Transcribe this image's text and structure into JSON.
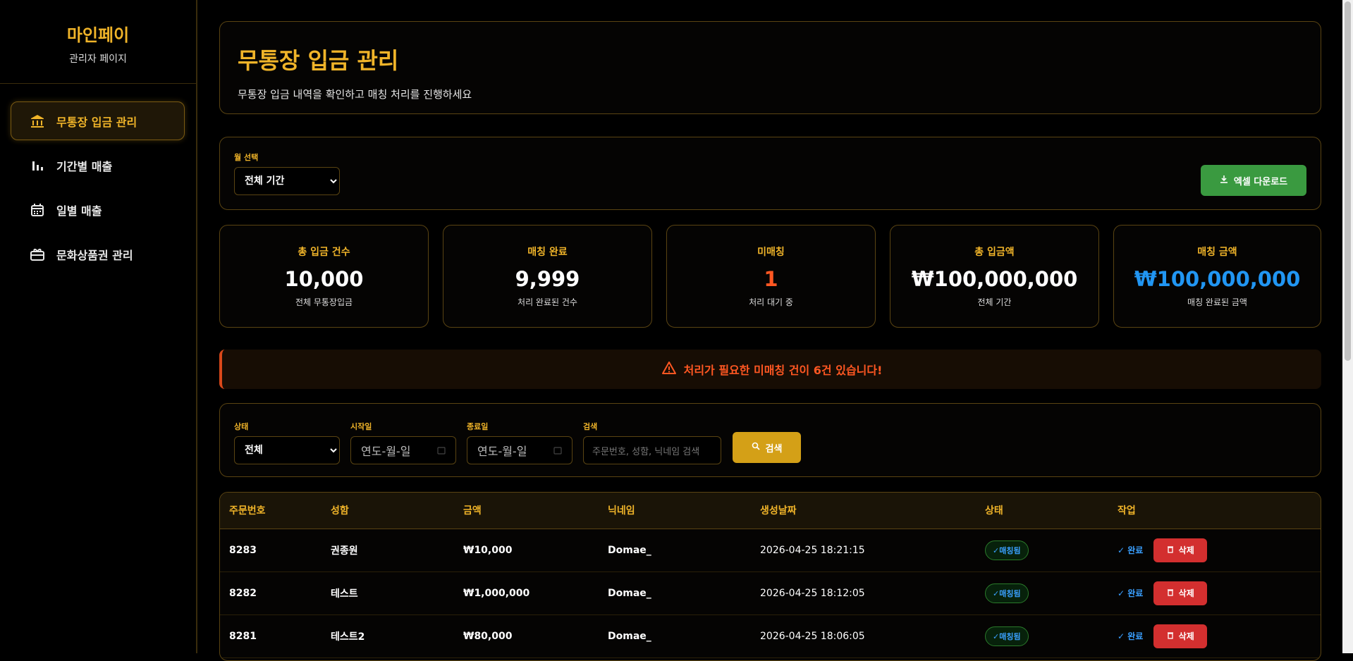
{
  "brand": {
    "title": "마인페이",
    "subtitle": "관리자 페이지"
  },
  "sidebar": {
    "items": [
      {
        "label": "무통장 입금 관리",
        "icon": "bank-icon",
        "active": true
      },
      {
        "label": "기간별 매출",
        "icon": "bar-chart-icon"
      },
      {
        "label": "일별 매출",
        "icon": "calendar-icon"
      },
      {
        "label": "문화상품권 관리",
        "icon": "gift-card-icon"
      }
    ]
  },
  "header": {
    "title": "무통장 입금 관리",
    "subtitle": "무통장 입금 내역을 확인하고 매칭 처리를 진행하세요"
  },
  "month": {
    "label": "월 선택",
    "selected": "전체 기간",
    "excel_button": "엑셀 다운로드"
  },
  "stats": [
    {
      "title": "총 입금 건수",
      "value": "10,000",
      "sub": "전체 무통장입금",
      "color": "#ffffff"
    },
    {
      "title": "매칭 완료",
      "value": "9,999",
      "sub": "처리 완료된 건수",
      "color": "#ffffff"
    },
    {
      "title": "미매칭",
      "value": "1",
      "sub": "처리 대기 중",
      "color": "#ff5722"
    },
    {
      "title": "총 입금액",
      "value": "₩100,000,000",
      "sub": "전체 기간",
      "color": "#ffffff"
    },
    {
      "title": "매칭 금액",
      "value": "₩100,000,000",
      "sub": "매칭 완료된 금액",
      "color": "#2196f3"
    }
  ],
  "alert": {
    "text": "처리가 필요한 미매칭 건이 6건 있습니다!"
  },
  "filters": {
    "status_label": "상태",
    "status_value": "전체",
    "start_label": "시작일",
    "start_placeholder": "연도-월-일",
    "end_label": "종료일",
    "end_placeholder": "연도-월-일",
    "search_label": "검색",
    "search_placeholder": "주문번호, 성함, 닉네임 검색",
    "search_button": "검색"
  },
  "table": {
    "headers": [
      "주문번호",
      "성함",
      "금액",
      "닉네임",
      "생성날짜",
      "상태",
      "작업"
    ],
    "rows": [
      {
        "order": "8283",
        "name": "권종원",
        "amount": "₩10,000",
        "nick": "Domae_",
        "date": "2026-04-25 18:21:15",
        "status": "✓매칭됨",
        "done": "✓ 완료",
        "delete": "삭제"
      },
      {
        "order": "8282",
        "name": "테스트",
        "amount": "₩1,000,000",
        "nick": "Domae_",
        "date": "2026-04-25 18:12:05",
        "status": "✓매칭됨",
        "done": "✓ 완료",
        "delete": "삭제"
      },
      {
        "order": "8281",
        "name": "테스트2",
        "amount": "₩80,000",
        "nick": "Domae_",
        "date": "2026-04-25 18:06:05",
        "status": "✓매칭됨",
        "done": "✓ 완료",
        "delete": "삭제"
      }
    ]
  }
}
